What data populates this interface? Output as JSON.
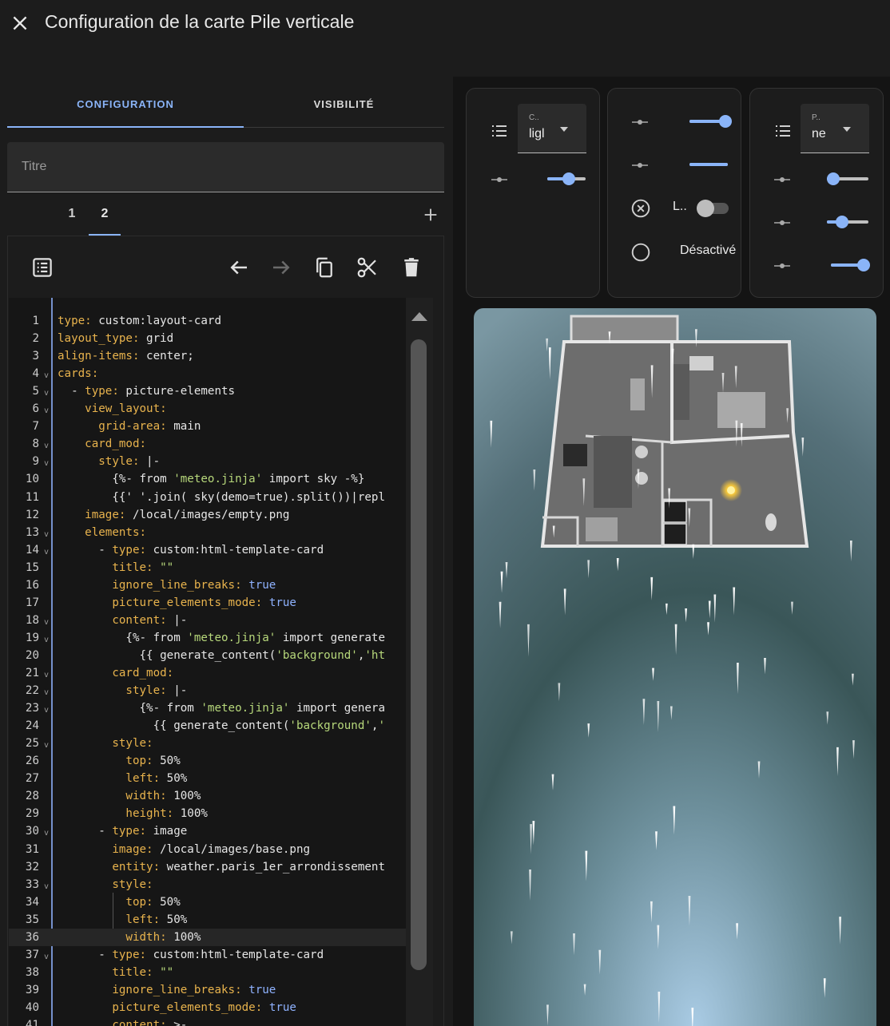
{
  "header": {
    "title": "Configuration de la carte Pile verticale",
    "close_icon": "close-icon"
  },
  "tabs": [
    {
      "label": "CONFIGURATION",
      "active": true
    },
    {
      "label": "VISIBILITÉ",
      "active": false
    }
  ],
  "title_field": {
    "placeholder": "Titre",
    "value": ""
  },
  "subtabs": [
    {
      "label": "1"
    },
    {
      "label": "2",
      "active": true
    }
  ],
  "colors": {
    "accent": "#8ab4f8",
    "background": "#1c1c1c",
    "key": "#e8b34d",
    "string": "#b7d87b",
    "bool": "#8fb2ff"
  },
  "code_lines": [
    "<span class=\"k\">type:</span> custom:layout-card",
    "<span class=\"k\">layout_type:</span> grid",
    "<span class=\"k\">align-items:</span> center;",
    "<span class=\"k\">cards:</span>",
    "  - <span class=\"k\">type:</span> picture-elements",
    "    <span class=\"k\">view_layout:</span>",
    "      <span class=\"k\">grid-area:</span> main",
    "    <span class=\"k\">card_mod:</span>",
    "      <span class=\"k\">style:</span> |-",
    "        {%- from <span class=\"s\">'meteo.jinja'</span> import sky -%}",
    "        {{' '.join( sky(demo=true).split())|repl",
    "    <span class=\"k\">image:</span> /local/images/empty.png",
    "    <span class=\"k\">elements:</span>",
    "      - <span class=\"k\">type:</span> custom:html-template-card",
    "        <span class=\"k\">title:</span> <span class=\"s\">\"\"</span>",
    "        <span class=\"k\">ignore_line_breaks:</span> <span class=\"b\">true</span>",
    "        <span class=\"k\">picture_elements_mode:</span> <span class=\"b\">true</span>",
    "        <span class=\"k\">content:</span> |-",
    "          {%- from <span class=\"s\">'meteo.jinja'</span> import generate",
    "            {{ generate_content(<span class=\"s\">'background'</span>,<span class=\"s\">'ht</span>",
    "        <span class=\"k\">card_mod:</span>",
    "          <span class=\"k\">style:</span> |-",
    "            {%- from <span class=\"s\">'meteo.jinja'</span> import genera",
    "              {{ generate_content(<span class=\"s\">'background'</span>,<span class=\"s\">'</span>",
    "        <span class=\"k\">style:</span>",
    "          <span class=\"k\">top:</span> 50%",
    "          <span class=\"k\">left:</span> 50%",
    "          <span class=\"k\">width:</span> 100%",
    "          <span class=\"k\">height:</span> 100%",
    "      - <span class=\"k\">type:</span> image",
    "        <span class=\"k\">image:</span> /local/images/base.png",
    "        <span class=\"k\">entity:</span> weather.paris_1er_arrondissement",
    "        <span class=\"k\">style:</span>",
    "          <span class=\"k\">top:</span> 50%",
    "          <span class=\"k\">left:</span> 50%",
    "          <span class=\"k\">width:</span> 100%",
    "      - <span class=\"k\">type:</span> custom:html-template-card",
    "        <span class=\"k\">title:</span> <span class=\"s\">\"\"</span>",
    "        <span class=\"k\">ignore_line_breaks:</span> <span class=\"b\">true</span>",
    "        <span class=\"k\">picture_elements_mode:</span> <span class=\"b\">true</span>",
    "        <span class=\"k\">content:</span> >-"
  ],
  "fold_lines": [
    4,
    5,
    6,
    8,
    9,
    13,
    14,
    18,
    19,
    21,
    22,
    23,
    25,
    30,
    33,
    37
  ],
  "current_line": 36,
  "preview": {
    "card1": {
      "select_label": "C..",
      "select_value": "ligl",
      "slider_value": 0.55
    },
    "card2": {
      "slider1_value": 1.0,
      "slider2_value": 1.0,
      "toggle_label": "L..",
      "off_label": "Désactivé"
    },
    "card3": {
      "select_label": "P..",
      "select_value": "ne",
      "slider1_value": 0.05,
      "slider2_value": 0.3,
      "slider3_value": 0.95
    }
  }
}
